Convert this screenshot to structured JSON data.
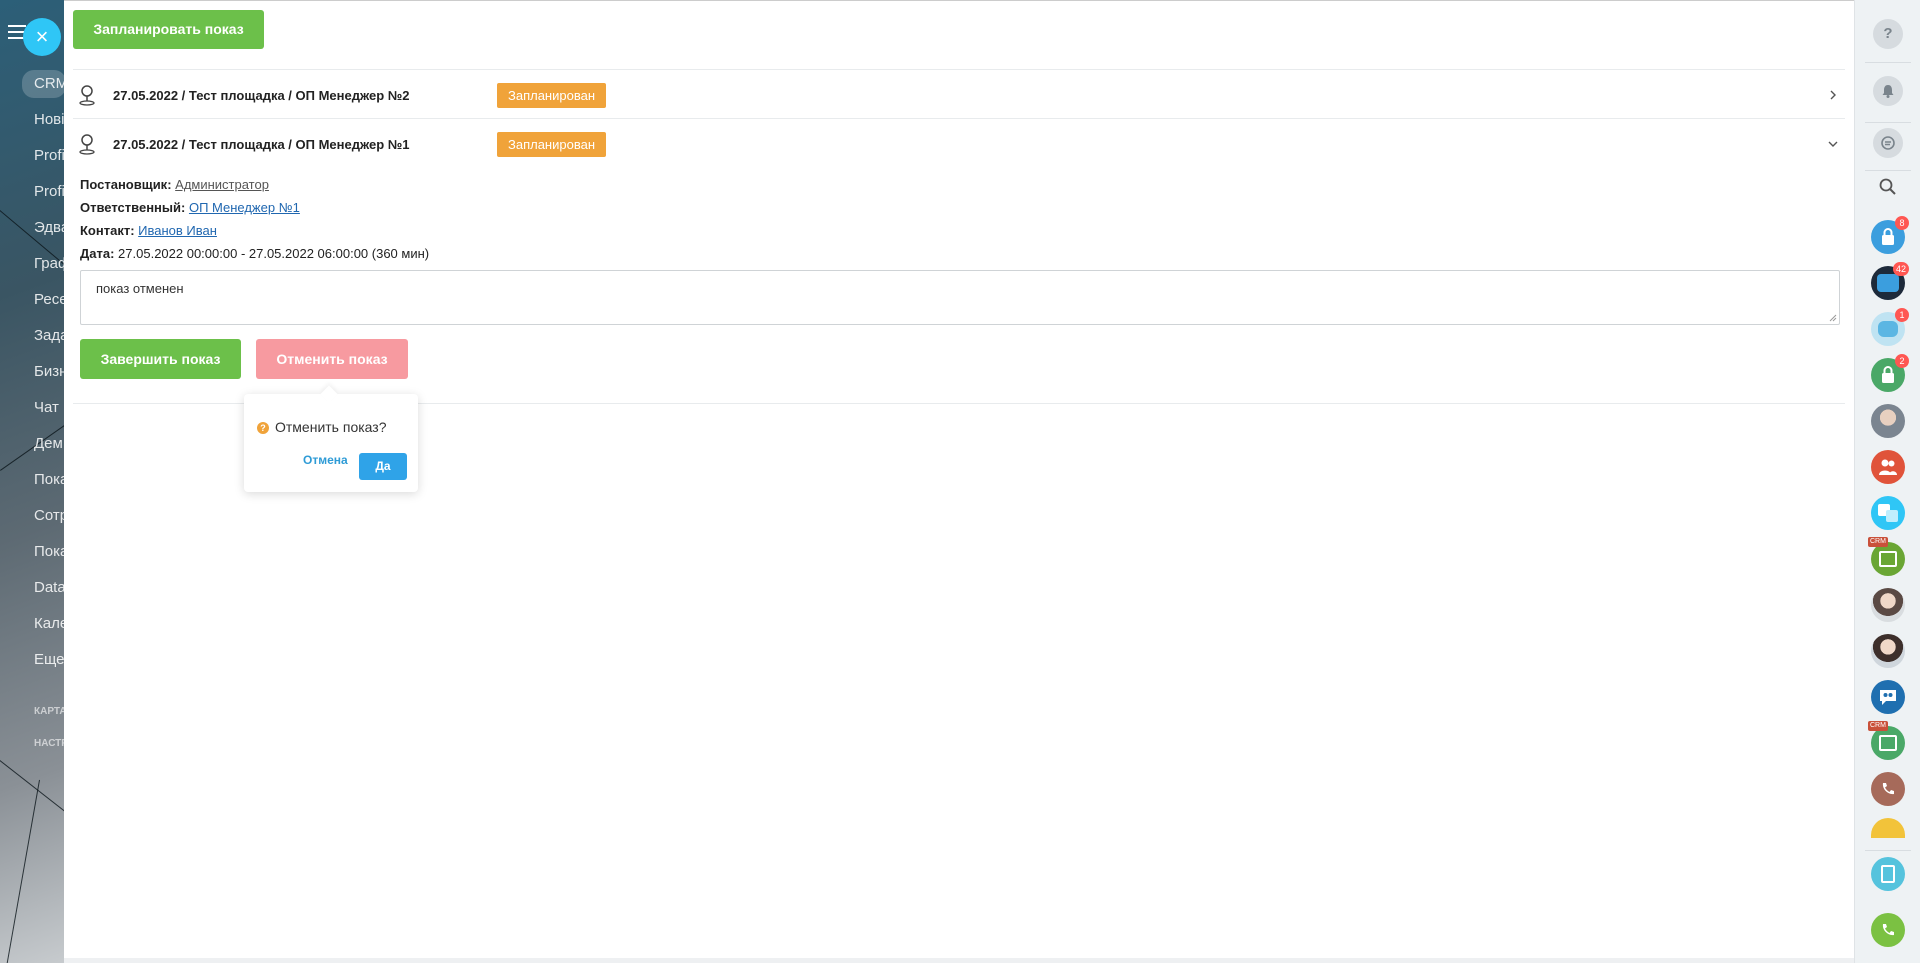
{
  "background": {
    "menu_items": [
      "CRM",
      "Нові",
      "Profi",
      "Profi",
      "Эдва",
      "Граф",
      "Ресе",
      "Зада",
      "Бизн",
      "Чат",
      "Дем",
      "Пока",
      "Сотр",
      "Пока",
      "Data",
      "Кале",
      "Еще"
    ],
    "small_labels": [
      "КАРТА",
      "НАСТР"
    ],
    "close_glyph": "×"
  },
  "panel": {
    "plan_button_label": "Запланировать показ",
    "showings": [
      {
        "title": "27.05.2022 / Тест площадка / ОП Менеджер №2",
        "status": "Запланирован",
        "expanded": false
      },
      {
        "title": "27.05.2022 / Тест площадка / ОП Менеджер №1",
        "status": "Запланирован",
        "expanded": true
      }
    ],
    "details": {
      "creator_label": "Постановщик:",
      "creator_value": "Администратор",
      "responsible_label": "Ответственный:",
      "responsible_value": "ОП Менеджер №1",
      "contact_label": "Контакт:",
      "contact_value": "Иванов Иван",
      "date_label": "Дата:",
      "date_value": "27.05.2022 00:00:00 - 27.05.2022 06:00:00 (360 мин)"
    },
    "comment_value": "показ отменен",
    "finish_button_label": "Завершить показ",
    "cancel_show_button_label": "Отменить показ",
    "popover": {
      "question": "Отменить показ?",
      "icon_glyph": "?",
      "cancel_label": "Отмена",
      "confirm_label": "Да"
    }
  },
  "right_bar": {
    "help_glyph": "?",
    "badges": {
      "lock_1": "8",
      "chat": "42",
      "bot": "1",
      "lock_2": "2"
    },
    "crm_tag": "CRM",
    "colors": {
      "green_accent": "#6cc04a",
      "status_orange": "#f0a33a",
      "cancel_pink": "#f79aa0",
      "blue_button": "#2fa3e8"
    }
  }
}
